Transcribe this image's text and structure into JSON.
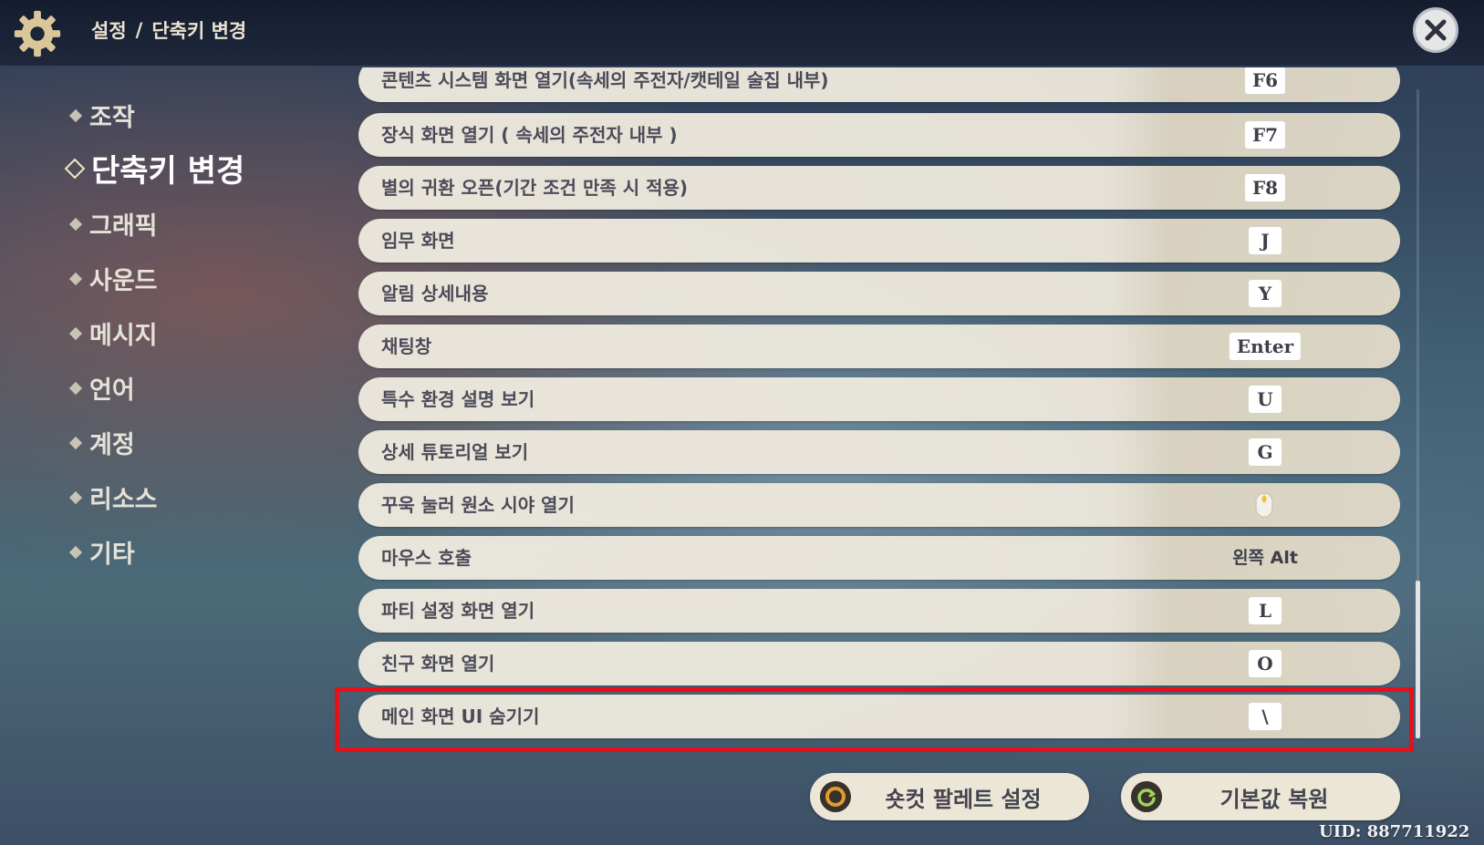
{
  "header": {
    "breadcrumb": [
      "설정",
      "/",
      "단축키 변경"
    ],
    "close_icon": "close-x-icon",
    "settings_icon": "gear-icon"
  },
  "sidebar": {
    "items": [
      {
        "label": "조작",
        "active": false
      },
      {
        "label": "단축키 변경",
        "active": true
      },
      {
        "label": "그래픽",
        "active": false
      },
      {
        "label": "사운드",
        "active": false
      },
      {
        "label": "메시지",
        "active": false
      },
      {
        "label": "언어",
        "active": false
      },
      {
        "label": "계정",
        "active": false
      },
      {
        "label": "리소스",
        "active": false
      },
      {
        "label": "기타",
        "active": false
      }
    ]
  },
  "keybinds": [
    {
      "action": "콘텐츠 시스템 화면 열기(속세의 주전자/캣테일 술집 내부)",
      "key": "F6"
    },
    {
      "action": "장식 화면 열기 ( 속세의 주전자 내부 )",
      "key": "F7"
    },
    {
      "action": "별의 귀환 오픈(기간 조건 만족 시 적용)",
      "key": "F8"
    },
    {
      "action": "임무 화면",
      "key": "J"
    },
    {
      "action": "알림 상세내용",
      "key": "Y"
    },
    {
      "action": "채팅창",
      "key": "Enter"
    },
    {
      "action": "특수 환경 설명 보기",
      "key": "U"
    },
    {
      "action": "상세 튜토리얼 보기",
      "key": "G"
    },
    {
      "action": "꾸욱 눌러 원소 시야 열기",
      "key": "",
      "key_icon": "mouse-middle-button-icon"
    },
    {
      "action": "마우스 호출",
      "key": "왼쪽 Alt"
    },
    {
      "action": "파티 설정 화면 열기",
      "key": "L"
    },
    {
      "action": "친구 화면 열기",
      "key": "O"
    },
    {
      "action": "메인 화면 UI 숨기기",
      "key": "\\",
      "highlighted": true
    }
  ],
  "buttons": {
    "palette_label": "숏컷 팔레트 설정",
    "reset_label": "기본값 복원"
  },
  "uid": "UID: 887711922",
  "colors": {
    "highlight": "#e4101a",
    "row_bg": "#ece7db",
    "text": "#4b4b58"
  }
}
